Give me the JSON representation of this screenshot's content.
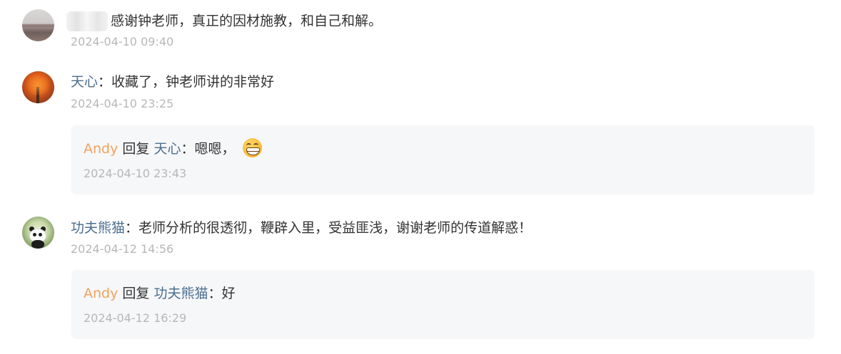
{
  "comments": [
    {
      "username": "",
      "separator": "",
      "content": "感谢钟老师，真正的因材施教，和自己和解。",
      "time": "2024-04-10 09:40"
    },
    {
      "username": "天心",
      "separator": "：",
      "content": "收藏了，钟老师讲的非常好",
      "time": "2024-04-10 23:25",
      "reply": {
        "author": "Andy",
        "verb": "回复",
        "target": "天心",
        "separator": "：",
        "content": "嗯嗯，",
        "emoji": "grinning-emoji-icon",
        "time": "2024-04-10 23:43"
      }
    },
    {
      "username": "功夫熊猫",
      "separator": "：",
      "content": "老师分析的很透彻，鞭辟入里，受益匪浅，谢谢老师的传道解惑！",
      "time": "2024-04-12 14:56",
      "reply": {
        "author": "Andy",
        "verb": "回复",
        "target": "功夫熊猫",
        "separator": "：",
        "content": "好",
        "time": "2024-04-12 16:29"
      }
    }
  ],
  "colors": {
    "username": "#4a6e8f",
    "reply_author": "#f3a25b",
    "timestamp": "#b7b7b7",
    "reply_background": "#f6f7f9",
    "text": "#333333"
  }
}
